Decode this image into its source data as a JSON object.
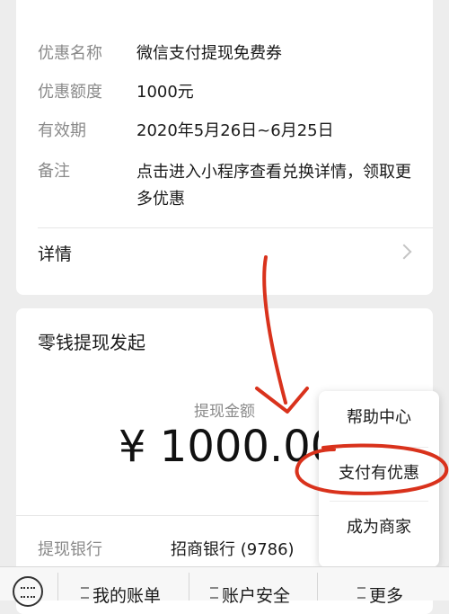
{
  "coupon": {
    "rows": [
      {
        "label": "优惠名称",
        "value": "微信支付提现免费券"
      },
      {
        "label": "优惠额度",
        "value": "1000元"
      },
      {
        "label": "有效期",
        "value": "2020年5月26日~6月25日"
      },
      {
        "label": "备注",
        "value": "点击进入小程序查看兑换详情，领取更多优惠"
      }
    ],
    "details_label": "详情"
  },
  "withdraw": {
    "title": "零钱提现发起",
    "amount_label": "提现金额",
    "amount": "¥ 1000.00",
    "bank_label": "提现银行",
    "bank_value": "招商银行 (9786)"
  },
  "popup_menu": {
    "items": [
      "帮助中心",
      "支付有优惠",
      "成为商家"
    ]
  },
  "bottom_bar": {
    "items": [
      "我的账单",
      "账户安全",
      "更多"
    ]
  },
  "colors": {
    "annotation_red": "#d9321c",
    "background": "#ededed",
    "label_gray": "#8a8a8a"
  },
  "icons": {
    "keyboard": "keyboard-icon",
    "chevron": "chevron-right-icon",
    "menu": "hamburger-icon"
  }
}
